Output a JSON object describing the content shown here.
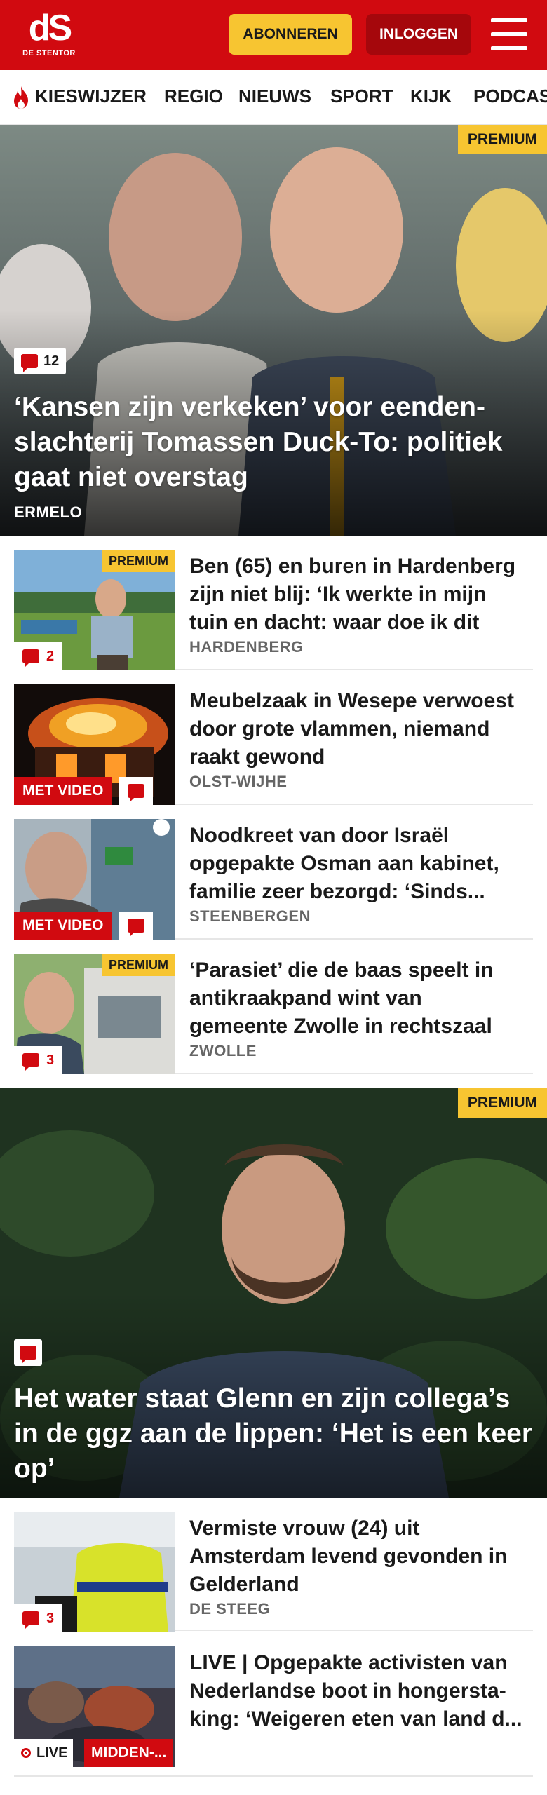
{
  "header": {
    "logo_mark": "dS",
    "logo_sub": "DE STENTOR",
    "subscribe_label": "ABONNEREN",
    "login_label": "INLOGGEN"
  },
  "nav": {
    "items": [
      "KIESWIJZER",
      "REGIO",
      "NIEUWS",
      "SPORT",
      "KIJK",
      "PODCAST"
    ]
  },
  "hero1": {
    "premium": "PREMIUM",
    "comments": "12",
    "title": "‘Kansen zijn verkeken’ voor eenden­slachterij Tomassen Duck-To: politiek gaat niet overstag",
    "location": "ERMELO"
  },
  "articles": [
    {
      "premium": "PREMIUM",
      "comments": "2",
      "title": "Ben (65) en buren in Hardenberg zijn niet blij: ‘Ik werkte in mijn tuin en dacht: waar doe ik dit no...",
      "location": "HARDENBERG"
    },
    {
      "video": "MET VIDEO",
      "title": "Meubelzaak in Wesepe verwoest door grote vlammen, niemand raakt gewond",
      "location": "OLST-WIJHE"
    },
    {
      "video": "MET VIDEO",
      "title": "Noodkreet van door Israël opgepakte Osman aan kabinet, familie zeer bezorgd: ‘Sinds...",
      "location": "STEENBERGEN"
    },
    {
      "premium": "PREMIUM",
      "comments": "3",
      "title": "‘Parasiet’ die de baas speelt in antikraakpand wint van gemeente Zwolle in rechtszaal",
      "location": "ZWOLLE"
    }
  ],
  "hero2": {
    "premium": "PREMIUM",
    "title": "Het water staat Glenn en zijn collega’s in de ggz aan de lippen: ‘Het is een keer op’"
  },
  "articles2": [
    {
      "comments": "3",
      "title": "Vermiste vrouw (24) uit Amsterdam levend gevonden in Gelderland",
      "location": "DE STEEG"
    },
    {
      "live": "LIVE",
      "region": "MIDDEN-...",
      "title": "LIVE | Opgepakte activisten van Nederlandse boot in hongersta­king: ‘Weigeren eten van land d...",
      "location": ""
    }
  ],
  "colors": {
    "brand_red": "#d10a10",
    "premium_yellow": "#f7c531",
    "login_dark_red": "#a5070c"
  }
}
